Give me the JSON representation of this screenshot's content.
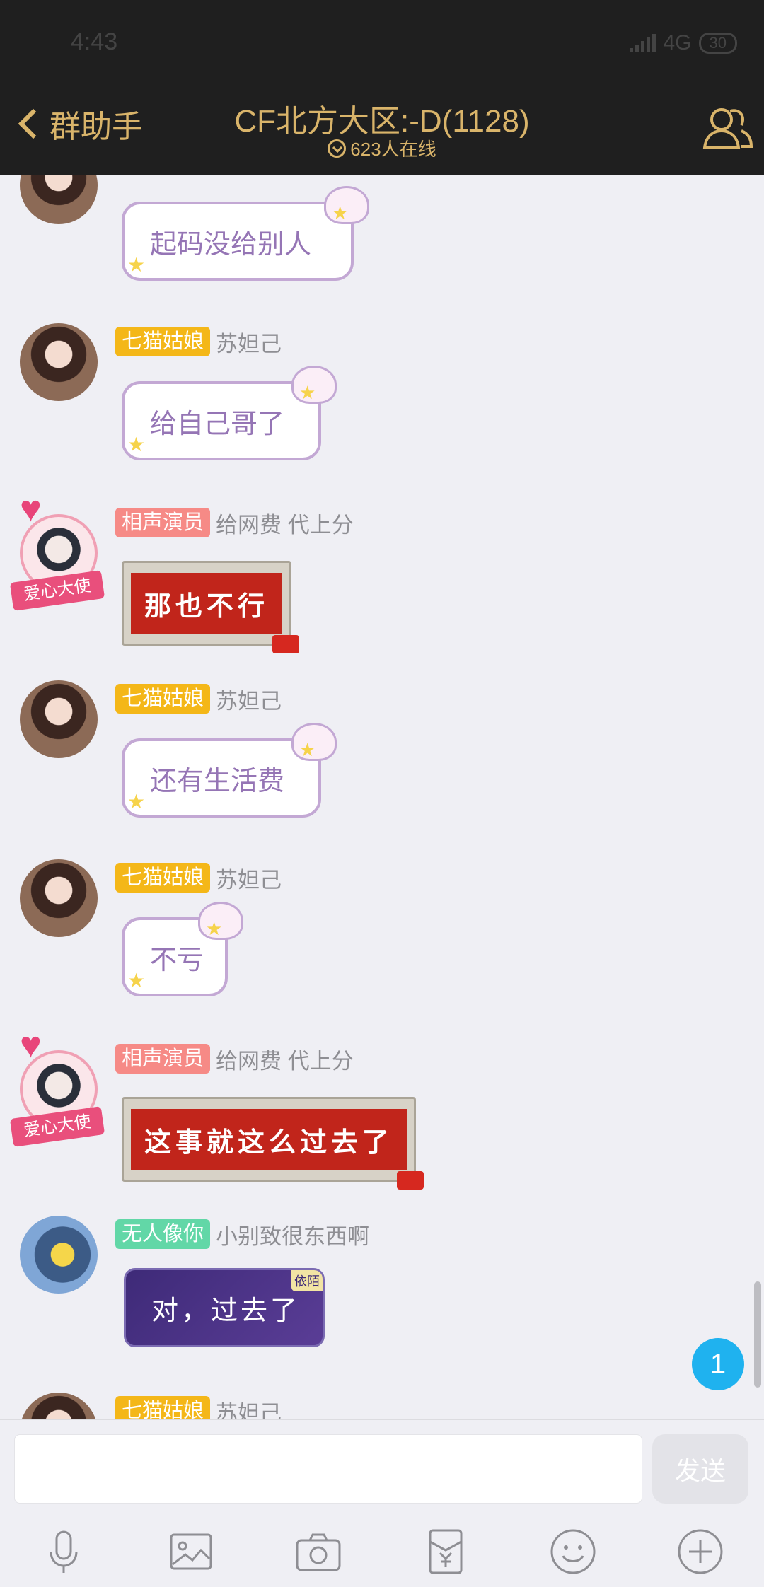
{
  "status": {
    "time": "4:43",
    "network": "4G",
    "battery": "30"
  },
  "header": {
    "back_label": "群助手",
    "title": "CF北方大区:-D(1128)",
    "online": "623人在线"
  },
  "messages": [
    {
      "tag": "",
      "nick": "",
      "text": "起码没给别人",
      "kind": "bubble"
    },
    {
      "tag": "七猫姑娘",
      "nick": "苏妲己",
      "text": "给自己哥了",
      "kind": "bubble"
    },
    {
      "tag": "相声演员",
      "nick": "给网费  代上分",
      "text": "那也不行",
      "kind": "sticker",
      "badge": "爱心大使"
    },
    {
      "tag": "七猫姑娘",
      "nick": "苏妲己",
      "text": "还有生活费",
      "kind": "bubble"
    },
    {
      "tag": "七猫姑娘",
      "nick": "苏妲己",
      "text": "不亏",
      "kind": "bubble"
    },
    {
      "tag": "相声演员",
      "nick": "给网费  代上分",
      "text": "这事就这么过去了",
      "kind": "sticker",
      "badge": "爱心大使"
    },
    {
      "tag": "无人像你",
      "nick": "小别致很东西啊",
      "text": "对，过去了",
      "kind": "sticker-purple",
      "corner": "依陌"
    },
    {
      "tag": "七猫姑娘",
      "nick": "苏妲己",
      "text": "",
      "kind": "partial"
    }
  ],
  "new_message_count": "1",
  "input": {
    "placeholder": "",
    "send_label": "发送"
  },
  "toolbar": [
    "microphone-icon",
    "image-icon",
    "camera-icon",
    "red-packet-icon",
    "emoji-icon",
    "plus-icon"
  ],
  "colors": {
    "header_bg": "#1f1f1f",
    "header_text": "#d9b46a",
    "bubble_border": "#c3a8d4",
    "bubble_text": "#9575b5",
    "badge_blue": "#1fb2ef"
  }
}
